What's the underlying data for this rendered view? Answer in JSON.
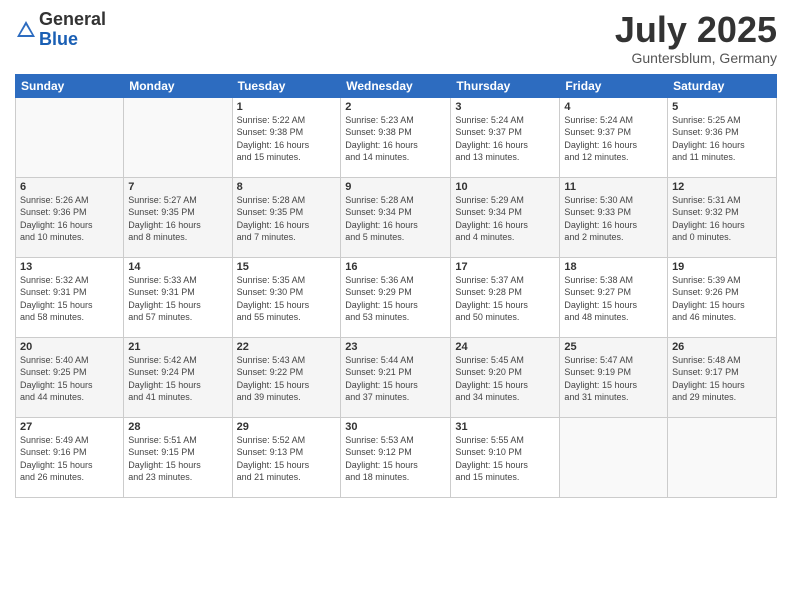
{
  "logo": {
    "general": "General",
    "blue": "Blue"
  },
  "title": "July 2025",
  "subtitle": "Guntersblum, Germany",
  "headers": [
    "Sunday",
    "Monday",
    "Tuesday",
    "Wednesday",
    "Thursday",
    "Friday",
    "Saturday"
  ],
  "weeks": [
    [
      {
        "day": "",
        "info": ""
      },
      {
        "day": "",
        "info": ""
      },
      {
        "day": "1",
        "info": "Sunrise: 5:22 AM\nSunset: 9:38 PM\nDaylight: 16 hours\nand 15 minutes."
      },
      {
        "day": "2",
        "info": "Sunrise: 5:23 AM\nSunset: 9:38 PM\nDaylight: 16 hours\nand 14 minutes."
      },
      {
        "day": "3",
        "info": "Sunrise: 5:24 AM\nSunset: 9:37 PM\nDaylight: 16 hours\nand 13 minutes."
      },
      {
        "day": "4",
        "info": "Sunrise: 5:24 AM\nSunset: 9:37 PM\nDaylight: 16 hours\nand 12 minutes."
      },
      {
        "day": "5",
        "info": "Sunrise: 5:25 AM\nSunset: 9:36 PM\nDaylight: 16 hours\nand 11 minutes."
      }
    ],
    [
      {
        "day": "6",
        "info": "Sunrise: 5:26 AM\nSunset: 9:36 PM\nDaylight: 16 hours\nand 10 minutes."
      },
      {
        "day": "7",
        "info": "Sunrise: 5:27 AM\nSunset: 9:35 PM\nDaylight: 16 hours\nand 8 minutes."
      },
      {
        "day": "8",
        "info": "Sunrise: 5:28 AM\nSunset: 9:35 PM\nDaylight: 16 hours\nand 7 minutes."
      },
      {
        "day": "9",
        "info": "Sunrise: 5:28 AM\nSunset: 9:34 PM\nDaylight: 16 hours\nand 5 minutes."
      },
      {
        "day": "10",
        "info": "Sunrise: 5:29 AM\nSunset: 9:34 PM\nDaylight: 16 hours\nand 4 minutes."
      },
      {
        "day": "11",
        "info": "Sunrise: 5:30 AM\nSunset: 9:33 PM\nDaylight: 16 hours\nand 2 minutes."
      },
      {
        "day": "12",
        "info": "Sunrise: 5:31 AM\nSunset: 9:32 PM\nDaylight: 16 hours\nand 0 minutes."
      }
    ],
    [
      {
        "day": "13",
        "info": "Sunrise: 5:32 AM\nSunset: 9:31 PM\nDaylight: 15 hours\nand 58 minutes."
      },
      {
        "day": "14",
        "info": "Sunrise: 5:33 AM\nSunset: 9:31 PM\nDaylight: 15 hours\nand 57 minutes."
      },
      {
        "day": "15",
        "info": "Sunrise: 5:35 AM\nSunset: 9:30 PM\nDaylight: 15 hours\nand 55 minutes."
      },
      {
        "day": "16",
        "info": "Sunrise: 5:36 AM\nSunset: 9:29 PM\nDaylight: 15 hours\nand 53 minutes."
      },
      {
        "day": "17",
        "info": "Sunrise: 5:37 AM\nSunset: 9:28 PM\nDaylight: 15 hours\nand 50 minutes."
      },
      {
        "day": "18",
        "info": "Sunrise: 5:38 AM\nSunset: 9:27 PM\nDaylight: 15 hours\nand 48 minutes."
      },
      {
        "day": "19",
        "info": "Sunrise: 5:39 AM\nSunset: 9:26 PM\nDaylight: 15 hours\nand 46 minutes."
      }
    ],
    [
      {
        "day": "20",
        "info": "Sunrise: 5:40 AM\nSunset: 9:25 PM\nDaylight: 15 hours\nand 44 minutes."
      },
      {
        "day": "21",
        "info": "Sunrise: 5:42 AM\nSunset: 9:24 PM\nDaylight: 15 hours\nand 41 minutes."
      },
      {
        "day": "22",
        "info": "Sunrise: 5:43 AM\nSunset: 9:22 PM\nDaylight: 15 hours\nand 39 minutes."
      },
      {
        "day": "23",
        "info": "Sunrise: 5:44 AM\nSunset: 9:21 PM\nDaylight: 15 hours\nand 37 minutes."
      },
      {
        "day": "24",
        "info": "Sunrise: 5:45 AM\nSunset: 9:20 PM\nDaylight: 15 hours\nand 34 minutes."
      },
      {
        "day": "25",
        "info": "Sunrise: 5:47 AM\nSunset: 9:19 PM\nDaylight: 15 hours\nand 31 minutes."
      },
      {
        "day": "26",
        "info": "Sunrise: 5:48 AM\nSunset: 9:17 PM\nDaylight: 15 hours\nand 29 minutes."
      }
    ],
    [
      {
        "day": "27",
        "info": "Sunrise: 5:49 AM\nSunset: 9:16 PM\nDaylight: 15 hours\nand 26 minutes."
      },
      {
        "day": "28",
        "info": "Sunrise: 5:51 AM\nSunset: 9:15 PM\nDaylight: 15 hours\nand 23 minutes."
      },
      {
        "day": "29",
        "info": "Sunrise: 5:52 AM\nSunset: 9:13 PM\nDaylight: 15 hours\nand 21 minutes."
      },
      {
        "day": "30",
        "info": "Sunrise: 5:53 AM\nSunset: 9:12 PM\nDaylight: 15 hours\nand 18 minutes."
      },
      {
        "day": "31",
        "info": "Sunrise: 5:55 AM\nSunset: 9:10 PM\nDaylight: 15 hours\nand 15 minutes."
      },
      {
        "day": "",
        "info": ""
      },
      {
        "day": "",
        "info": ""
      }
    ]
  ]
}
